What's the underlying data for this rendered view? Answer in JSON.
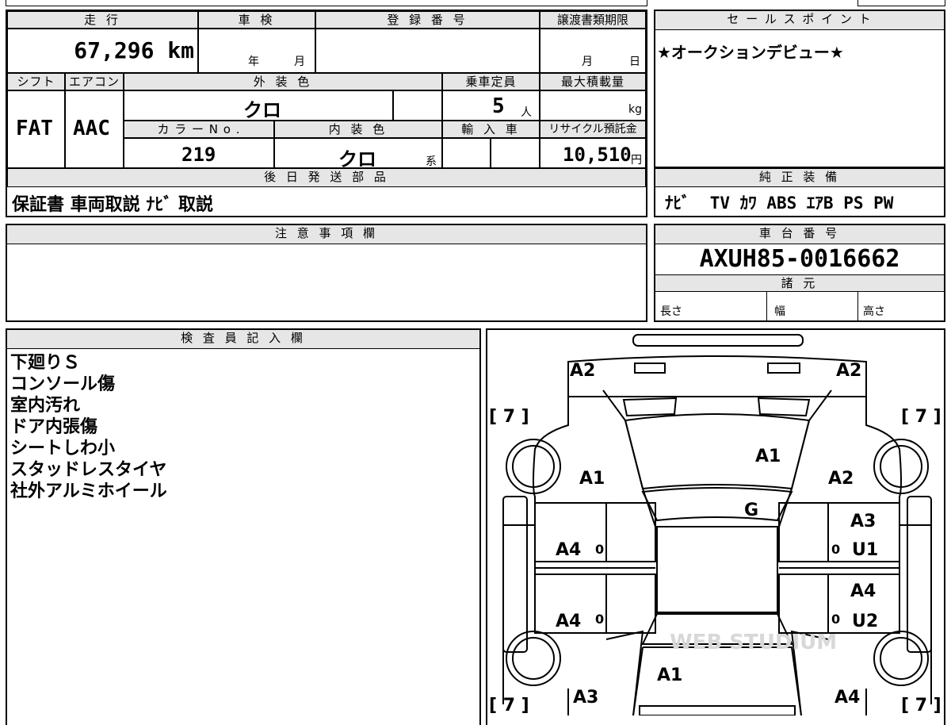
{
  "top_table": {
    "mileage_label": "走 行",
    "mileage_value": "67,296 km",
    "inspection_label": "車 検",
    "inspection_year": "年",
    "inspection_month": "月",
    "reg_label": "登 録 番 号",
    "transfer_label": "譲渡書類期限",
    "transfer_month": "月",
    "transfer_day": "日",
    "shift_label": "シフト",
    "shift_value": "FAT",
    "aircon_label": "エアコン",
    "aircon_value": "AAC",
    "ext_color_label": "外 装 色",
    "ext_color_value": "クロ",
    "capacity_label": "乗車定員",
    "capacity_value": "5",
    "capacity_unit": "人",
    "maxload_label": "最大積載量",
    "maxload_unit": "kg",
    "color_no_label": "カ ラ ー N o .",
    "color_no_value": "219",
    "int_color_label": "内 装 色",
    "int_color_value": "クロ",
    "int_color_suffix": "系",
    "import_label": "輸 入 車",
    "recycle_label": "リサイクル預託金",
    "recycle_value": "10,510",
    "recycle_unit": "円",
    "later_parts_label": "後 日 発 送 部 品",
    "later_parts_value": "保証書 車両取説 ﾅﾋﾞ 取説"
  },
  "sales_point": {
    "label": "セ ー ル ス ポ イ ン ト",
    "value": "★オークションデビュー★"
  },
  "equipment": {
    "label": "純 正 装 備",
    "value": "ﾅﾋﾞ  TV ｶﾜ ABS ｴｱB PS PW"
  },
  "caution": {
    "label": "注 意 事 項 欄"
  },
  "chassis": {
    "label": "車 台 番 号",
    "value": "AXUH85-0016662",
    "spec_label": "諸 元",
    "length_label": "長さ",
    "width_label": "幅",
    "height_label": "高さ"
  },
  "inspector": {
    "label": "検 査 員 記 入 欄",
    "notes": [
      "下廻りＳ",
      "コンソール傷",
      "室内汚れ",
      "ドア内張傷",
      "シートしわ小",
      "スタッドレスタイヤ",
      "社外アルミホイール"
    ]
  },
  "diagram": {
    "tl_a2": "A2",
    "tr_a2": "A2",
    "tire_tl": "[ 7 ]",
    "tire_tr": "[ 7 ]",
    "tire_bl": "[ 7 ]",
    "tire_br": "[ 7 ]",
    "hood_a1": "A1",
    "left_fender_a1": "A1",
    "right_fender_a2": "A2",
    "glass_g": "G",
    "left_front_door_a4": "A4",
    "left_rear_door_a4": "A4",
    "right_front_door_a3": "A3",
    "right_front_door_u1": "U1",
    "right_rear_door_a4": "A4",
    "right_rear_door_u2": "U2",
    "rear_a1": "A1",
    "rear_left_a3": "A3",
    "rear_right_a4": "A4",
    "zero_lf": "0",
    "zero_lr": "0",
    "zero_rf": "0",
    "zero_rr": "0",
    "watermark": "WEB STUDIUM"
  }
}
